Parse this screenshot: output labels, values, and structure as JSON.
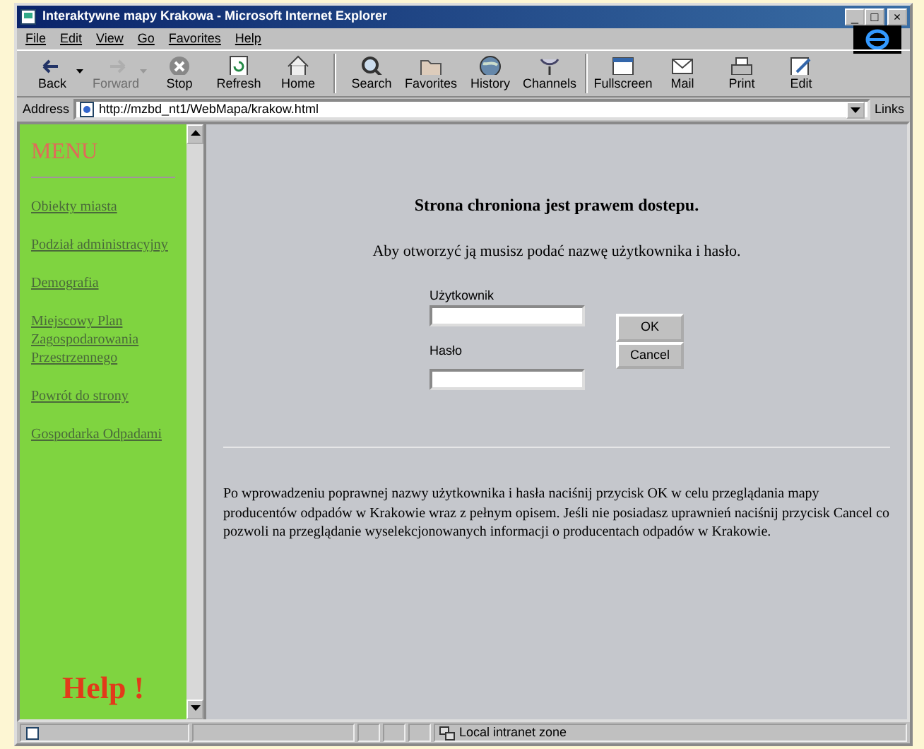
{
  "window": {
    "title": "Interaktywne mapy Krakowa - Microsoft Internet Explorer",
    "controls": [
      "_",
      "□",
      "×"
    ]
  },
  "menu": [
    "File",
    "Edit",
    "View",
    "Go",
    "Favorites",
    "Help"
  ],
  "toolbar": [
    {
      "label": "Back",
      "disabled": false,
      "dropdown": true
    },
    {
      "label": "Forward",
      "disabled": true,
      "dropdown": true
    },
    {
      "label": "Stop",
      "disabled": false,
      "dropdown": false
    },
    {
      "label": "Refresh",
      "disabled": false,
      "dropdown": false
    },
    {
      "label": "Home",
      "disabled": false,
      "dropdown": false
    },
    {
      "label": "Search",
      "disabled": false,
      "dropdown": false
    },
    {
      "label": "Favorites",
      "disabled": false,
      "dropdown": false
    },
    {
      "label": "History",
      "disabled": false,
      "dropdown": false
    },
    {
      "label": "Channels",
      "disabled": false,
      "dropdown": false
    },
    {
      "label": "Fullscreen",
      "disabled": false,
      "dropdown": false
    },
    {
      "label": "Mail",
      "disabled": false,
      "dropdown": false
    },
    {
      "label": "Print",
      "disabled": false,
      "dropdown": false
    },
    {
      "label": "Edit",
      "disabled": false,
      "dropdown": false
    }
  ],
  "address": {
    "label": "Address",
    "value": "http://mzbd_nt1/WebMapa/krakow.html",
    "links": "Links"
  },
  "sidebar": {
    "title": "MENU",
    "items": [
      "Obiekty miasta",
      "Podział administracyjny",
      "Demografia",
      "Miejscowy Plan Zagospodarowania Przestrzennego",
      "Powrót do strony",
      "Gospodarka Odpadami"
    ],
    "help": "Help !"
  },
  "login": {
    "heading": "Strona chroniona jest prawem dostepu.",
    "intro": "Aby otworzyć ją musisz podać nazwę użytkownika i hasło.",
    "user_label": "Użytkownik",
    "password_label": "Hasło",
    "ok": "OK",
    "cancel": "Cancel"
  },
  "note": "Po wprowadzeniu poprawnej nazwy użytkownika i hasła naciśnij przycisk OK w celu przeglądania mapy producentów odpadów w Krakowie wraz z pełnym opisem. Jeśli nie posiadasz uprawnień naciśnij przycisk Cancel co pozwoli na przeglądanie wyselekcjonowanych informacji o producentach odpadów w Krakowie.",
  "status_bar": {
    "zone": "Local intranet zone"
  }
}
